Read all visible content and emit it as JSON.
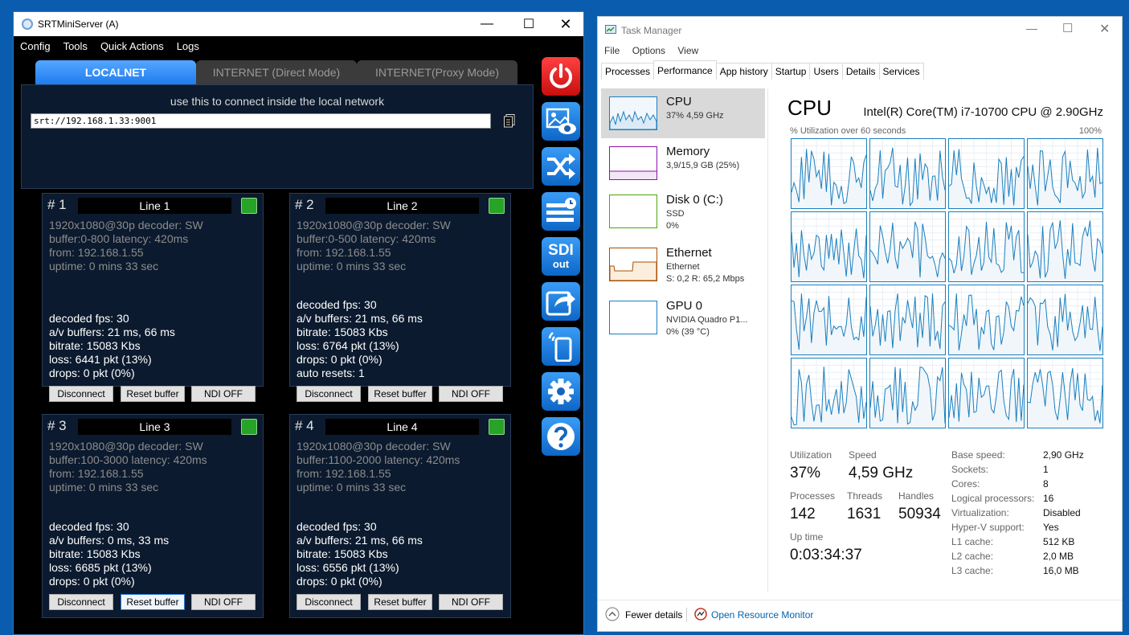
{
  "srt": {
    "title": "SRTMiniServer (A)",
    "menu": [
      "Config",
      "Tools",
      "Quick Actions",
      "Logs"
    ],
    "tabs": [
      "LOCALNET",
      "INTERNET (Direct Mode)",
      "INTERNET(Proxy Mode)"
    ],
    "hint": "use this to connect inside the local network",
    "url": "srt://192.168.1.33:9001",
    "lines": [
      {
        "num": "# 1",
        "name": "Line 1",
        "info": [
          "1920x1080@30p decoder: SW",
          "buffer:0-800 latency: 420ms",
          "from: 192.168.1.55",
          "uptime:  0 mins 33 sec"
        ],
        "stats": [
          "decoded fps: 30",
          "a/v buffers: 21 ms, 66 ms",
          "bitrate: 15083 Kbs",
          "loss: 6441 pkt (13%)",
          "drops: 0 pkt (0%)"
        ]
      },
      {
        "num": "# 2",
        "name": "Line 2",
        "info": [
          "1920x1080@30p decoder: SW",
          "buffer:0-500 latency: 420ms",
          "from: 192.168.1.55",
          "uptime:  0 mins 33 sec"
        ],
        "stats": [
          "decoded fps: 30",
          "a/v buffers: 21 ms, 66 ms",
          "bitrate: 15083 Kbs",
          "loss: 6764 pkt (13%)",
          "drops: 0 pkt (0%)",
          "auto resets: 1"
        ]
      },
      {
        "num": "# 3",
        "name": "Line 3",
        "info": [
          "1920x1080@30p decoder: SW",
          "buffer:100-3000 latency: 420ms",
          "from: 192.168.1.55",
          "uptime:  0 mins 33 sec"
        ],
        "stats": [
          "decoded fps: 30",
          "a/v buffers: 0 ms, 33 ms",
          "bitrate: 15083 Kbs",
          "loss: 6685 pkt (13%)",
          "drops: 0 pkt (0%)"
        ]
      },
      {
        "num": "# 4",
        "name": "Line 4",
        "info": [
          "1920x1080@30p decoder: SW",
          "buffer:1100-2000 latency: 420ms",
          "from: 192.168.1.55",
          "uptime:  0 mins 33 sec"
        ],
        "stats": [
          "decoded fps: 30",
          "a/v buffers: 21 ms, 66 ms",
          "bitrate: 15083 Kbs",
          "loss: 6556 pkt (13%)",
          "drops: 0 pkt (0%)"
        ]
      }
    ],
    "buttons": {
      "disconnect": "Disconnect",
      "reset": "Reset buffer",
      "ndi": "NDI OFF"
    },
    "sdi": [
      "SDI",
      "out"
    ],
    "side_icons": [
      "power-icon",
      "image-preview-icon",
      "shuffle-icon",
      "schedule-icon",
      "sdi-out-icon",
      "share-icon",
      "mobile-icon",
      "settings-icon",
      "help-icon"
    ],
    "colors": {
      "accent": "#1f7cf0",
      "led": "#27a327",
      "power": "#e01a1a"
    }
  },
  "tm": {
    "title": "Task Manager",
    "menu": [
      "File",
      "Options",
      "View"
    ],
    "tabs": [
      "Processes",
      "Performance",
      "App history",
      "Startup",
      "Users",
      "Details",
      "Services"
    ],
    "resources": [
      {
        "name": "CPU",
        "sub1": "37% 4,59 GHz",
        "color": "#1a7fbe"
      },
      {
        "name": "Memory",
        "sub1": "3,9/15,9 GB (25%)",
        "color": "#8b12ae"
      },
      {
        "name": "Disk 0 (C:)",
        "sub1": "SSD",
        "sub2": "0%",
        "color": "#4da60c"
      },
      {
        "name": "Ethernet",
        "sub1": "Ethernet",
        "sub2": "S: 0,2  R: 65,2 Mbps",
        "color": "#a74f01"
      },
      {
        "name": "GPU 0",
        "sub1": "NVIDIA Quadro P1...",
        "sub2": "0%  (39 °C)",
        "color": "#1a7fbe"
      }
    ],
    "cpu": {
      "title": "CPU",
      "model": "Intel(R) Core(TM) i7-10700 CPU @ 2.90GHz",
      "util_label": "% Utilization over 60 seconds",
      "util_max": "100%",
      "utilization_label": "Utilization",
      "utilization": "37%",
      "speed_label": "Speed",
      "speed": "4,59 GHz",
      "processes_label": "Processes",
      "processes": "142",
      "threads_label": "Threads",
      "threads": "1631",
      "handles_label": "Handles",
      "handles": "50934",
      "uptime_label": "Up time",
      "uptime": "0:03:34:37",
      "specs": [
        {
          "k": "Base speed:",
          "v": "2,90 GHz"
        },
        {
          "k": "Sockets:",
          "v": "1"
        },
        {
          "k": "Cores:",
          "v": "8"
        },
        {
          "k": "Logical processors:",
          "v": "16"
        },
        {
          "k": "Virtualization:",
          "v": "Disabled"
        },
        {
          "k": "Hyper-V support:",
          "v": "Yes"
        },
        {
          "k": "L1 cache:",
          "v": "512 KB"
        },
        {
          "k": "L2 cache:",
          "v": "2,0 MB"
        },
        {
          "k": "L3 cache:",
          "v": "16,0 MB"
        }
      ]
    },
    "fewer_details": "Fewer details",
    "open_monitor": "Open Resource Monitor",
    "colors": {
      "cpu": "#1a7fbe",
      "memory": "#8b12ae",
      "disk": "#4da60c",
      "ethernet": "#a74f01",
      "link": "#0063b1"
    }
  }
}
